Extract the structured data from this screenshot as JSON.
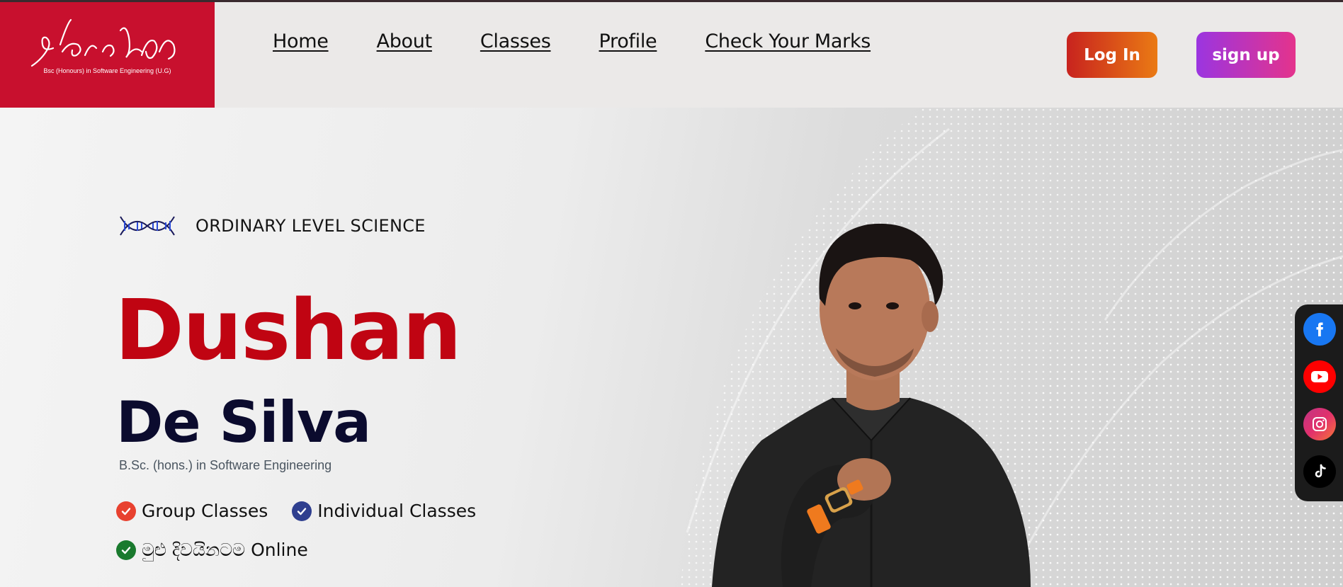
{
  "brand": {
    "subtitle": "Bsc (Honours) in Software Engineering (U.G)",
    "color": "#c8102e"
  },
  "nav": {
    "items": [
      "Home",
      "About",
      "Classes",
      "Profile",
      "Check Your Marks"
    ]
  },
  "auth": {
    "login_label": "Log In",
    "signup_label": "sign up"
  },
  "hero": {
    "tag": "ORDINARY LEVEL SCIENCE",
    "first_name": "Dushan",
    "last_name": "De Silva",
    "degree": "B.Sc. (hons.) in Software Engineering",
    "features": [
      {
        "label": "Group Classes",
        "color": "#e8412f"
      },
      {
        "label": "Individual Classes",
        "color": "#2f3f8f"
      },
      {
        "label": "මුළු දිවයිනටම Online",
        "color": "#1a7a2e"
      }
    ]
  },
  "social": {
    "icons": [
      "facebook-icon",
      "youtube-icon",
      "instagram-icon",
      "tiktok-icon"
    ]
  },
  "colors": {
    "accent_red": "#c00412",
    "dark_navy": "#0b0b2e"
  }
}
